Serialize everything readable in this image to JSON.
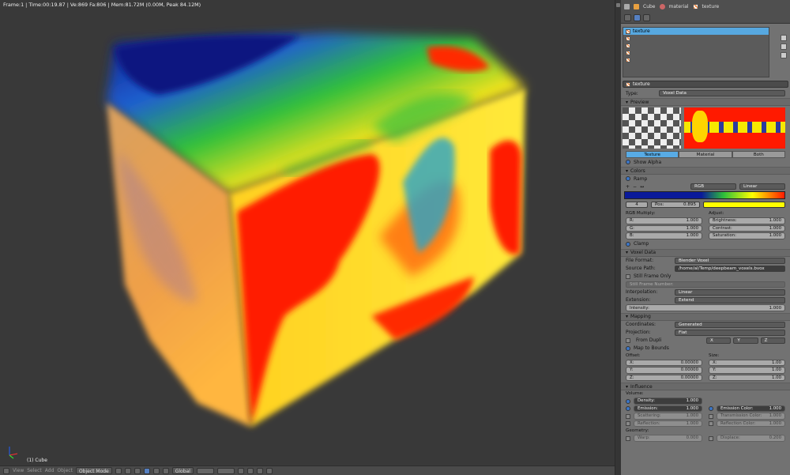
{
  "viewport": {
    "info_line": "Frame:1 | Time:00:19.87 | Ve:869 Fa:806 | Mem:81.72M (0.00M, Peak 84.12M)",
    "object_label": "(1) Cube",
    "menu": [
      "View",
      "Select",
      "Add",
      "Object"
    ],
    "mode": "Object Mode",
    "orientation": "Global"
  },
  "properties": {
    "breadcrumb": [
      "Cube",
      "material",
      "texture"
    ],
    "slots": [
      "texture",
      "",
      "",
      "",
      ""
    ],
    "texture_name": "texture",
    "type_label": "Type:",
    "type_value": "Voxel Data",
    "preview": {
      "title": "Preview",
      "tabs": [
        "Texture",
        "Material",
        "Both"
      ],
      "show_alpha": "Show Alpha"
    },
    "colors": {
      "title": "Colors",
      "ramp_label": "Ramp",
      "color_mode": "RGB",
      "interp": "Linear",
      "index": "4",
      "pos_label": "Pos:",
      "pos_value": "0.895",
      "rgb_multiply": "RGB Multiply:",
      "adjust": "Adjust:",
      "r_label": "R:",
      "r": "1.000",
      "g_label": "G:",
      "g": "1.000",
      "b_label": "B:",
      "b": "1.000",
      "brightness_label": "Brightness:",
      "brightness": "1.000",
      "contrast_label": "Contrast:",
      "contrast": "1.000",
      "saturation_label": "Saturation:",
      "saturation": "1.000",
      "clamp": "Clamp"
    },
    "voxel": {
      "title": "Voxel Data",
      "file_format_label": "File Format:",
      "file_format": "Blender Voxel",
      "source_path_label": "Source Path:",
      "source_path": "/home/al/Temp/deepbeam_voxels.bvox",
      "still_frame": "Still Frame Only",
      "still_frame_number": "Still Frame Number:",
      "interpolation_label": "Interpolation:",
      "interpolation": "Linear",
      "extension_label": "Extension:",
      "extension": "Extend",
      "intensity_label": "Intensity:",
      "intensity": "1.000"
    },
    "mapping": {
      "title": "Mapping",
      "coordinates_label": "Coordinates:",
      "coordinates": "Generated",
      "projection_label": "Projection:",
      "projection": "Flat",
      "from_dupli": "From Dupli",
      "axis_x": "X",
      "axis_y": "Y",
      "axis_z": "Z",
      "map_to_bounds": "Map to Bounds",
      "offset_label": "Offset:",
      "size_label": "Size:",
      "ox_label": "X:",
      "ox": "0.00000",
      "oy_label": "Y:",
      "oy": "0.00000",
      "oz_label": "Z:",
      "oz": "0.00000",
      "sx_label": "X:",
      "sx": "1.00",
      "sy_label": "Y:",
      "sy": "1.00",
      "sz_label": "Z:",
      "sz": "1.00"
    },
    "influence": {
      "title": "Influence",
      "volume_label": "Volume:",
      "density_label": "Density:",
      "density": "1.000",
      "emission_label": "Emission:",
      "emission": "1.000",
      "emission_color_label": "Emission Color:",
      "emission_color": "1.000",
      "scattering_label": "Scattering:",
      "scattering": "1.000",
      "transmission_color_label": "Transmission Color:",
      "transmission_color": "1.000",
      "reflection_label": "Reflection:",
      "reflection": "1.000",
      "reflection_color_label": "Reflection Color:",
      "reflection_color": "1.000",
      "geometry_label": "Geometry:",
      "warp_label": "Warp:",
      "warp": "0.000",
      "displace_label": "Displace:",
      "displace": "0.200"
    }
  },
  "colors": {
    "accent": "#57a8e0",
    "ramp_red": "#ff1a00",
    "ramp_yellow": "#ffff00",
    "ramp_green": "#2fc03a",
    "ramp_blue": "#0a1a9a"
  }
}
